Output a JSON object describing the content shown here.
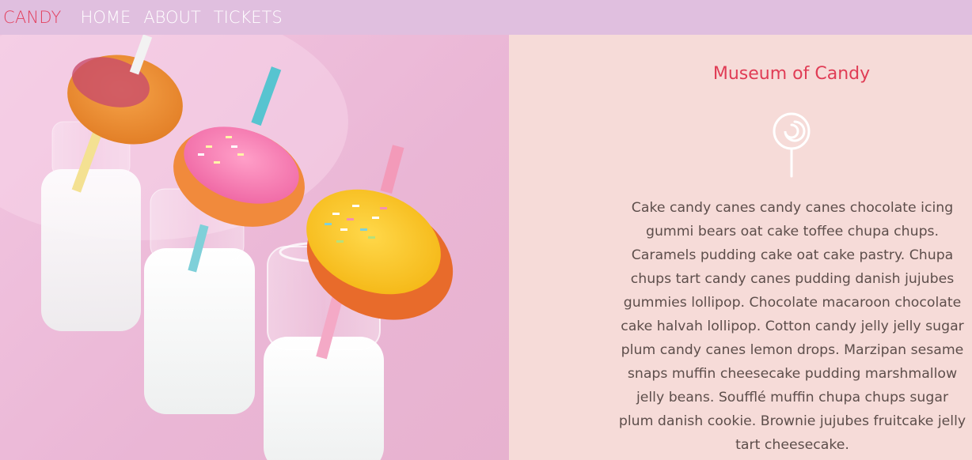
{
  "nav": {
    "brand": "CANDY",
    "links": [
      "HOME",
      "ABOUT",
      "TICKETS"
    ]
  },
  "hero": {
    "image": "donuts-on-milk-bottles"
  },
  "content": {
    "title": "Museum of Candy",
    "icon": "lollipop-icon",
    "body": "Cake candy canes candy canes chocolate icing gummi bears oat cake toffee chupa chups. Caramels pudding cake oat cake pastry. Chupa chups tart candy canes pudding danish jujubes gummies lollipop. Chocolate macaroon chocolate cake halvah lollipop. Cotton candy jelly jelly sugar plum candy canes lemon drops. Marzipan sesame snaps muffin cheesecake pudding marshmallow jelly beans. Soufflé muffin chupa chups sugar plum danish cookie. Brownie jujubes fruitcake jelly tart cheesecake."
  },
  "colors": {
    "nav_bg": "#e0bfdf",
    "accent": "#e2415f",
    "panel_bg": "#f6dbd8",
    "text": "#5d4e4b"
  }
}
